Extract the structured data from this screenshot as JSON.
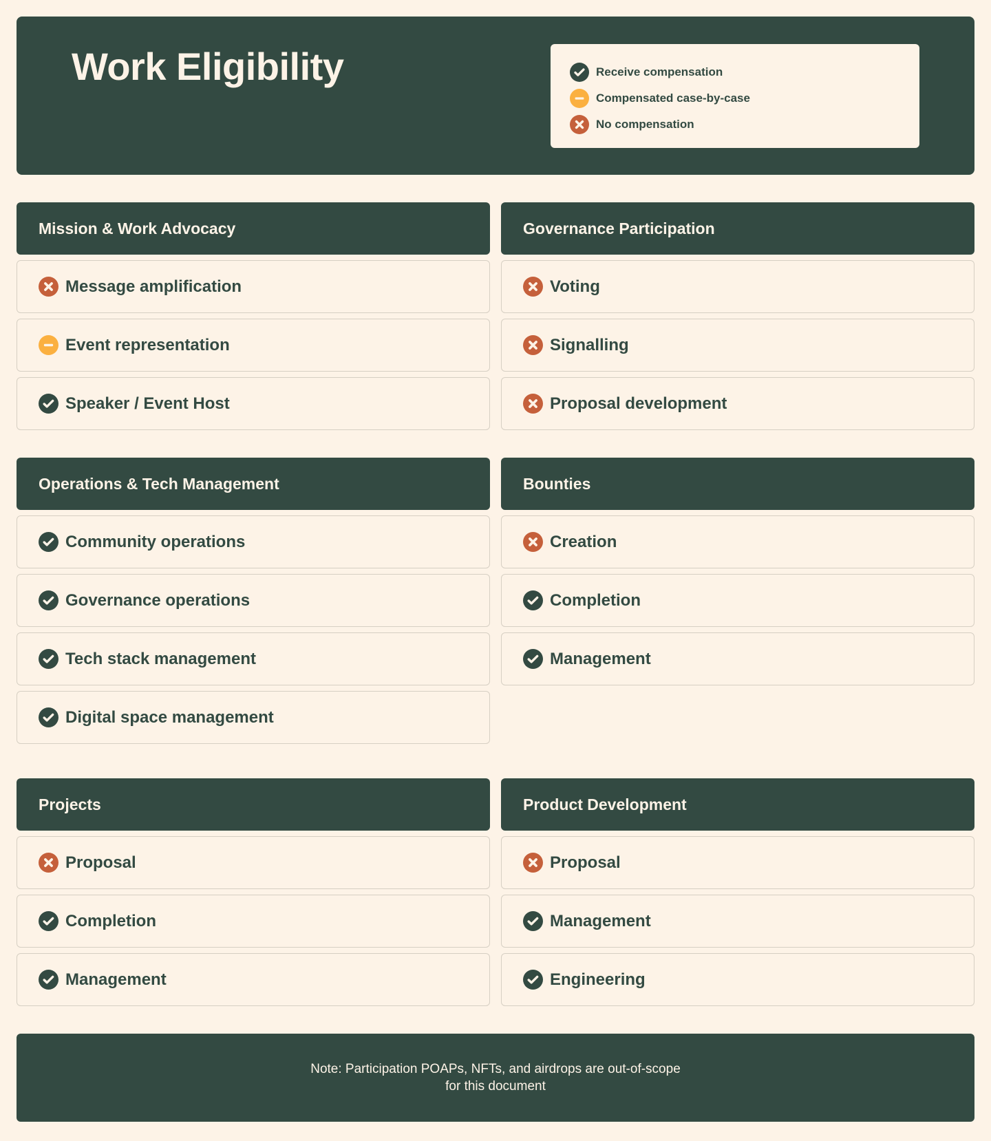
{
  "header": {
    "title": "Work Eligibility"
  },
  "colors": {
    "dark": "#334a42",
    "cream": "#fdf3e7",
    "yes": "#334a42",
    "maybe": "#fbb040",
    "no": "#c5603b"
  },
  "legend": [
    {
      "status": "yes",
      "icon": "check-circle-icon",
      "label": "Receive compensation"
    },
    {
      "status": "maybe",
      "icon": "minus-circle-icon",
      "label": "Compensated case-by-case"
    },
    {
      "status": "no",
      "icon": "x-circle-icon",
      "label": "No compensation"
    }
  ],
  "groups": [
    {
      "title": "Mission & Work Advocacy",
      "items": [
        {
          "label": "Message amplification",
          "status": "no"
        },
        {
          "label": "Event representation",
          "status": "maybe"
        },
        {
          "label": "Speaker / Event Host",
          "status": "yes"
        }
      ]
    },
    {
      "title": "Governance Participation",
      "items": [
        {
          "label": "Voting",
          "status": "no"
        },
        {
          "label": "Signalling",
          "status": "no"
        },
        {
          "label": "Proposal development",
          "status": "no"
        }
      ]
    },
    {
      "title": "Operations & Tech Management",
      "items": [
        {
          "label": "Community operations",
          "status": "yes"
        },
        {
          "label": "Governance operations",
          "status": "yes"
        },
        {
          "label": "Tech stack management",
          "status": "yes"
        },
        {
          "label": "Digital space management",
          "status": "yes"
        }
      ]
    },
    {
      "title": "Bounties",
      "items": [
        {
          "label": "Creation",
          "status": "no"
        },
        {
          "label": "Completion",
          "status": "yes"
        },
        {
          "label": "Management",
          "status": "yes"
        }
      ]
    },
    {
      "title": "Projects",
      "items": [
        {
          "label": "Proposal",
          "status": "no"
        },
        {
          "label": "Completion",
          "status": "yes"
        },
        {
          "label": "Management",
          "status": "yes"
        }
      ]
    },
    {
      "title": "Product Development",
      "items": [
        {
          "label": "Proposal",
          "status": "no"
        },
        {
          "label": "Management",
          "status": "yes"
        },
        {
          "label": "Engineering",
          "status": "yes"
        }
      ]
    }
  ],
  "note": {
    "text": "Note: Participation POAPs, NFTs, and airdrops are out-of-scope for this document"
  }
}
